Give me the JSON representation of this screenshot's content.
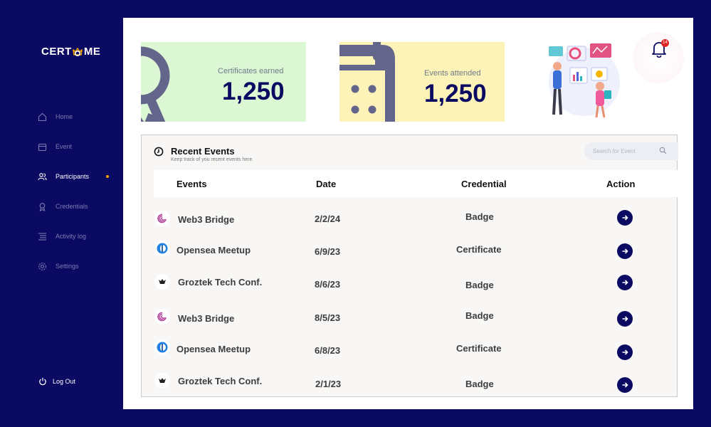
{
  "app": {
    "logo_left": "CERT",
    "logo_right": "ME"
  },
  "sidebar": {
    "items": [
      {
        "label": "Home",
        "icon": "home-icon"
      },
      {
        "label": "Event",
        "icon": "calendar-icon"
      },
      {
        "label": "Participants",
        "icon": "users-icon",
        "active": true
      },
      {
        "label": "Credentials",
        "icon": "award-icon"
      },
      {
        "label": "Activity log",
        "icon": "list-icon"
      },
      {
        "label": "Settings",
        "icon": "gear-icon"
      }
    ],
    "logout": "Log Out"
  },
  "stats": {
    "certificates_label": "Certificates earned",
    "certificates_value": "1,250",
    "events_label": "Events attended",
    "events_value": "1,250"
  },
  "notifications": {
    "count": "14"
  },
  "recent_events": {
    "title": "Recent Events",
    "subtitle": "Keep track of you recent events here",
    "search_placeholder": "Search for Event",
    "columns": [
      "Events",
      "Date",
      "Credential",
      "Action"
    ],
    "rows": [
      {
        "name": "Web3 Bridge",
        "date": "2/2/24",
        "credential": "Badge",
        "icon": "web3-bridge-logo"
      },
      {
        "name": "Opensea Meetup",
        "date": "6/9/23",
        "credential": "Certificate",
        "icon": "opensea-logo"
      },
      {
        "name": "Groztek Tech Conf.",
        "date": "8/6/23",
        "credential": "Badge",
        "icon": "groztek-logo"
      },
      {
        "name": "Web3 Bridge",
        "date": "8/5/23",
        "credential": "Badge",
        "icon": "web3-bridge-logo"
      },
      {
        "name": "Opensea Meetup",
        "date": "6/8/23",
        "credential": "Certificate",
        "icon": "opensea-logo"
      },
      {
        "name": "Groztek Tech Conf.",
        "date": "2/1/23",
        "credential": "Badge",
        "icon": "groztek-logo"
      }
    ]
  },
  "colors": {
    "navy": "#0b0a62",
    "accent_gold": "#f0a500",
    "green_card": "#dcf7d4",
    "yellow_card": "#fdf2b7"
  }
}
